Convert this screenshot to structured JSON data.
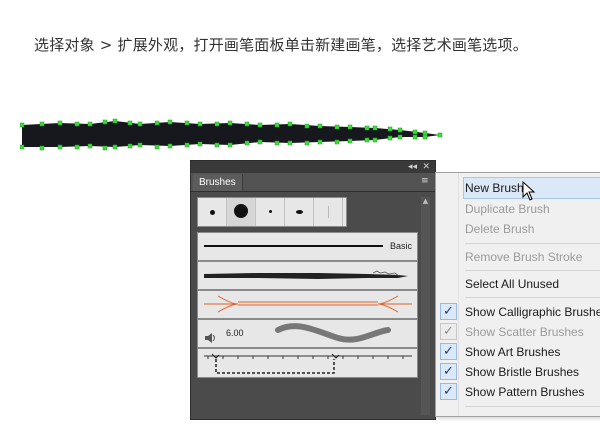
{
  "instruction": "选择对象 > 扩展外观，打开画笔面板单击新建画笔，选择艺术画笔选项。",
  "panel": {
    "tab_label": "Brushes",
    "collapse_icon": "collapse-arrows-icon",
    "close_icon": "close-icon",
    "menu_icon": "panel-menu-icon",
    "brush_library": {
      "basic_label": "Basic",
      "calligraphic_size": "6.00"
    }
  },
  "menu": {
    "items": [
      {
        "label": "New Brush...",
        "enabled": true,
        "highlighted": true
      },
      {
        "label": "Duplicate Brush",
        "enabled": false
      },
      {
        "label": "Delete Brush",
        "enabled": false
      },
      {
        "label": "Remove Brush Stroke",
        "enabled": false
      },
      {
        "label": "Select All Unused",
        "enabled": true
      },
      {
        "label": "Show Calligraphic Brushes",
        "enabled": true,
        "checked": true
      },
      {
        "label": "Show Scatter Brushes",
        "enabled": false,
        "checked": true
      },
      {
        "label": "Show Art Brushes",
        "enabled": true,
        "checked": true
      },
      {
        "label": "Show Bristle Brushes",
        "enabled": true,
        "checked": true
      },
      {
        "label": "Show Pattern Brushes",
        "enabled": true,
        "checked": true
      }
    ]
  },
  "colors": {
    "selection_anchor": "#3ddc3d",
    "panel_bg": "#4b4b4b",
    "menu_highlight": "#dbe8f7",
    "check_blue": "#1f3f78",
    "pattern_brush_orange": "#e0622a"
  }
}
